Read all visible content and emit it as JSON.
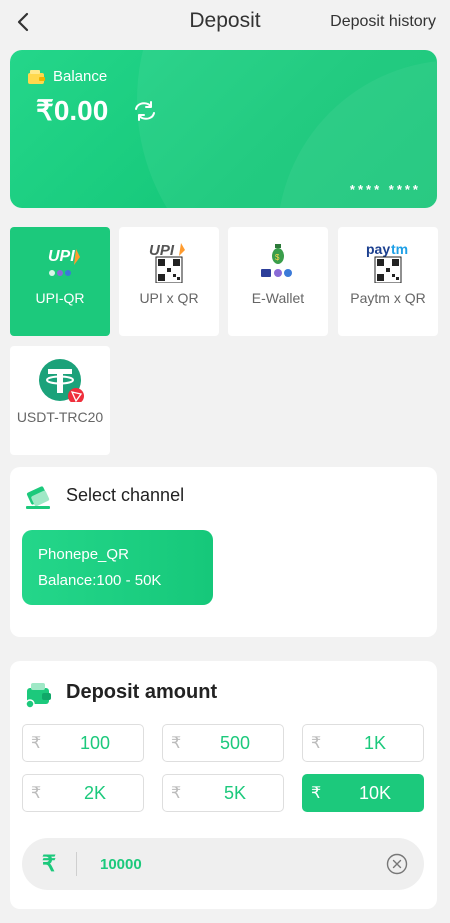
{
  "header": {
    "title": "Deposit",
    "history_link": "Deposit history"
  },
  "balance": {
    "label": "Balance",
    "value": "₹0.00",
    "masked": "****    ****"
  },
  "payment_methods": [
    {
      "label": "UPI-QR",
      "active": true
    },
    {
      "label": "UPI x QR",
      "active": false
    },
    {
      "label": "E-Wallet",
      "active": false
    },
    {
      "label": "Paytm x QR",
      "active": false
    },
    {
      "label": "USDT-TRC20",
      "active": false
    }
  ],
  "channel": {
    "title": "Select channel",
    "name": "Phonepe_QR",
    "range": "Balance:100 - 50K"
  },
  "amount": {
    "title": "Deposit amount",
    "currency_symbol": "₹",
    "options": [
      "100",
      "500",
      "1K",
      "2K",
      "5K",
      "10K"
    ],
    "selected": "10K",
    "input_value": "10000"
  },
  "colors": {
    "accent": "#1cc97c",
    "background": "#f2f2f2"
  },
  "icons": [
    "back-arrow-icon",
    "wallet-icon",
    "refresh-icon",
    "upi-logo-icon",
    "qr-code-icon",
    "paytm-logo-icon",
    "money-bag-icon",
    "tether-icon",
    "tron-icon",
    "card-icon",
    "wallet-card-icon",
    "clear-icon"
  ]
}
